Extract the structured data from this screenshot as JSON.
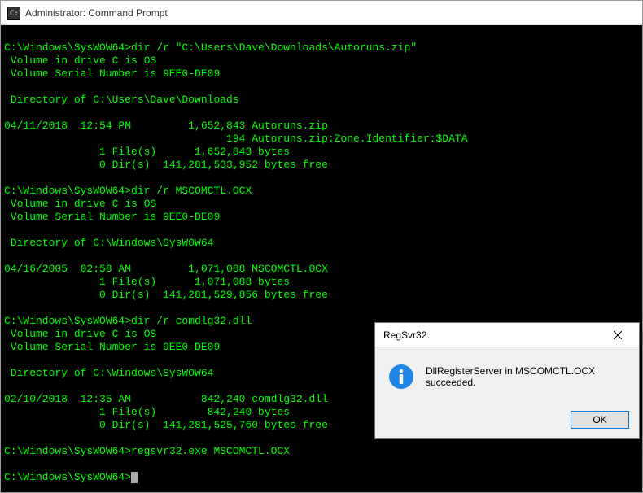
{
  "window": {
    "title": "Administrator: Command Prompt"
  },
  "terminal": {
    "lines": [
      "",
      "C:\\Windows\\SysWOW64>dir /r \"C:\\Users\\Dave\\Downloads\\Autoruns.zip\"",
      " Volume in drive C is OS",
      " Volume Serial Number is 9EE0-DE09",
      "",
      " Directory of C:\\Users\\Dave\\Downloads",
      "",
      "04/11/2018  12:54 PM         1,652,843 Autoruns.zip",
      "                                   194 Autoruns.zip:Zone.Identifier:$DATA",
      "               1 File(s)      1,652,843 bytes",
      "               0 Dir(s)  141,281,533,952 bytes free",
      "",
      "C:\\Windows\\SysWOW64>dir /r MSCOMCTL.OCX",
      " Volume in drive C is OS",
      " Volume Serial Number is 9EE0-DE09",
      "",
      " Directory of C:\\Windows\\SysWOW64",
      "",
      "04/16/2005  02:58 AM         1,071,088 MSCOMCTL.OCX",
      "               1 File(s)      1,071,088 bytes",
      "               0 Dir(s)  141,281,529,856 bytes free",
      "",
      "C:\\Windows\\SysWOW64>dir /r comdlg32.dll",
      " Volume in drive C is OS",
      " Volume Serial Number is 9EE0-DE09",
      "",
      " Directory of C:\\Windows\\SysWOW64",
      "",
      "02/10/2018  12:35 AM           842,240 comdlg32.dll",
      "               1 File(s)        842,240 bytes",
      "               0 Dir(s)  141,281,525,760 bytes free",
      "",
      "C:\\Windows\\SysWOW64>regsvr32.exe MSCOMCTL.OCX",
      "",
      "C:\\Windows\\SysWOW64>"
    ]
  },
  "dialog": {
    "title": "RegSvr32",
    "message": "DllRegisterServer in MSCOMCTL.OCX succeeded.",
    "ok_label": "OK"
  }
}
